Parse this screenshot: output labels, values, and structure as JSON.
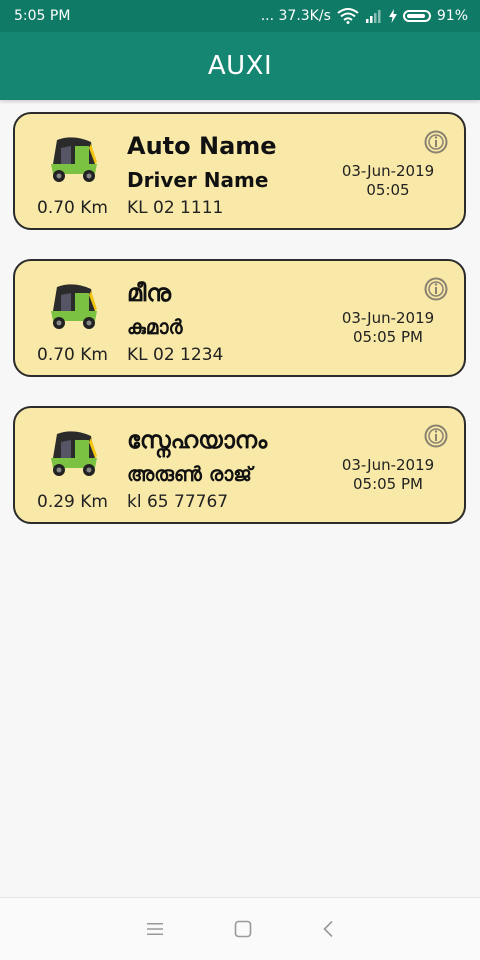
{
  "status_bar": {
    "time": "5:05 PM",
    "network_speed": "... 37.3K/s",
    "battery_percent": "91%"
  },
  "app_bar": {
    "title": "AUXI"
  },
  "autos": [
    {
      "auto_name": "Auto Name",
      "driver_name": "Driver Name",
      "plate": "KL 02 1111",
      "distance": "0.70 Km",
      "date": "03-Jun-2019",
      "time": "05:05"
    },
    {
      "auto_name": "മീനു",
      "driver_name": "കുമാർ",
      "plate": "KL 02 1234",
      "distance": "0.70 Km",
      "date": "03-Jun-2019",
      "time": "05:05 PM"
    },
    {
      "auto_name": "സ്നേഹയാനം",
      "driver_name": "അരുൺ രാജ്",
      "plate": "kl 65 77767",
      "distance": "0.29 Km",
      "date": "03-Jun-2019",
      "time": "05:05 PM"
    }
  ],
  "colors": {
    "primary": "#158672",
    "status_bar": "#0f7a66",
    "card_background": "#f9e9a8",
    "card_border": "#2b2b2b"
  },
  "icons": {
    "card_leading": "auto-rickshaw-icon",
    "card_trailing": "info-icon",
    "nav": [
      "menu-icon",
      "home-icon",
      "back-icon"
    ]
  }
}
